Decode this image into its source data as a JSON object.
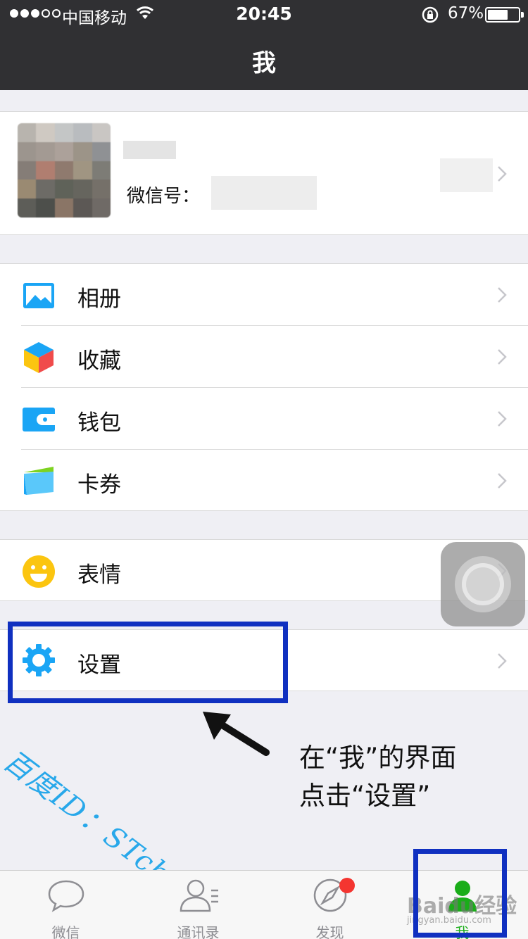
{
  "status_bar": {
    "carrier": "中国移动",
    "time": "20:45",
    "battery_percent": "67%",
    "battery_level": 0.67
  },
  "nav": {
    "title": "我"
  },
  "profile": {
    "wechat_id_label": "微信号："
  },
  "groups": {
    "g1": [
      {
        "label": "相册",
        "icon": "album-icon"
      },
      {
        "label": "收藏",
        "icon": "favorites-icon"
      },
      {
        "label": "钱包",
        "icon": "wallet-icon"
      },
      {
        "label": "卡券",
        "icon": "card-coupon-icon"
      }
    ],
    "g2": [
      {
        "label": "表情",
        "icon": "sticker-smiley-icon"
      }
    ],
    "g3": [
      {
        "label": "设置",
        "icon": "settings-gear-icon"
      }
    ]
  },
  "annotation": {
    "line1": "在“我”的界面",
    "line2": "点击“设置”",
    "handwriting": "百度ID：STchiyuhai"
  },
  "watermark": {
    "main": "Baidu经验",
    "sub": "jingyan.baidu.com"
  },
  "tabs": [
    {
      "label": "微信",
      "icon": "chat-bubble-icon"
    },
    {
      "label": "通讯录",
      "icon": "contacts-icon"
    },
    {
      "label": "发现",
      "icon": "compass-icon"
    },
    {
      "label": "我",
      "icon": "me-person-icon"
    }
  ],
  "colors": {
    "nav_bg": "#303033",
    "accent_green": "#1aad19",
    "annotation_box": "#1030c0",
    "badge_red": "#f43530"
  }
}
